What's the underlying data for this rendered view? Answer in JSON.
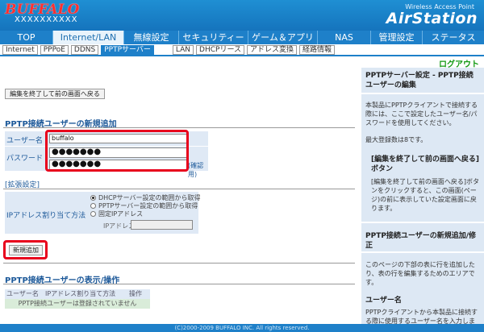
{
  "header": {
    "logo": "BUFFALO",
    "model": "XXXXXXXXXX",
    "brand_sub": "Wireless Access Point",
    "brand": "AirStation"
  },
  "main_nav": [
    {
      "label": "TOP",
      "active": false
    },
    {
      "label": "Internet/LAN",
      "active": true
    },
    {
      "label": "無線設定",
      "active": false
    },
    {
      "label": "セキュリティー",
      "active": false
    },
    {
      "label": "ゲーム＆アプリ",
      "active": false
    },
    {
      "label": "NAS",
      "active": false
    },
    {
      "label": "管理設定",
      "active": false
    },
    {
      "label": "ステータス",
      "active": false
    }
  ],
  "sub_nav": [
    {
      "label": "Internet",
      "active": false
    },
    {
      "label": "PPPoE",
      "active": false
    },
    {
      "label": "DDNS",
      "active": false
    },
    {
      "label": "PPTPサーバー",
      "active": true
    },
    {
      "label": "LAN",
      "active": false
    },
    {
      "label": "DHCPリース",
      "active": false
    },
    {
      "label": "アドレス変換",
      "active": false
    },
    {
      "label": "経路情報",
      "active": false
    }
  ],
  "logout": "ログアウト",
  "back_button": "編集を終了して前の画面へ戻る",
  "add_section": {
    "title": "PPTP接続ユーザーの新規追加",
    "username_label": "ユーザー名",
    "username_value": "buffalo",
    "password_label": "パスワード",
    "password_value": "●●●●●●●",
    "password_confirm_value": "●●●●●●●",
    "confirm_label": "(確認用)"
  },
  "advanced": {
    "title": "[拡張設定]",
    "ip_method_label": "IPアドレス割り当て方法",
    "options": [
      "DHCPサーバー設定の範囲から取得",
      "PPTPサーバー設定の範囲から取得",
      "固定IPアドレス"
    ],
    "ip_label": "IPアドレス"
  },
  "add_button": "新規追加",
  "list_section": {
    "title": "PPTP接続ユーザーの表示/操作",
    "columns": [
      "ユーザー名",
      "IPアドレス割り当て方法",
      "操作"
    ],
    "empty_message": "PPTP接続ユーザーは登録されていません"
  },
  "side": {
    "h1": "PPTPサーバー設定 - PPTP接続ユーザーの編集",
    "p1": "本製品にPPTPクライアントで接続する際には、ここで設定したユーザー名/パスワードを使用してください。",
    "p2": "最大登録数は8です。",
    "h2": "[編集を終了して前の画面へ戻る]ボタン",
    "p3": "[編集を終了して前の画面へ戻る]ボタンをクリックすると、この画面(ページ)の前に表示していた設定画面に戻ります。",
    "h3": "PPTP接続ユーザーの新規追加/修正",
    "p4": "このページの下部の表に行を追加したり、表の行を編集するためのエリアです。",
    "h4": "ユーザー名",
    "p5": "PPTPクライアントから本製品に接続する際に使用するユーザー名を入力します"
  },
  "footer": "(C)2000-2009 BUFFALO INC. All rights reserved."
}
